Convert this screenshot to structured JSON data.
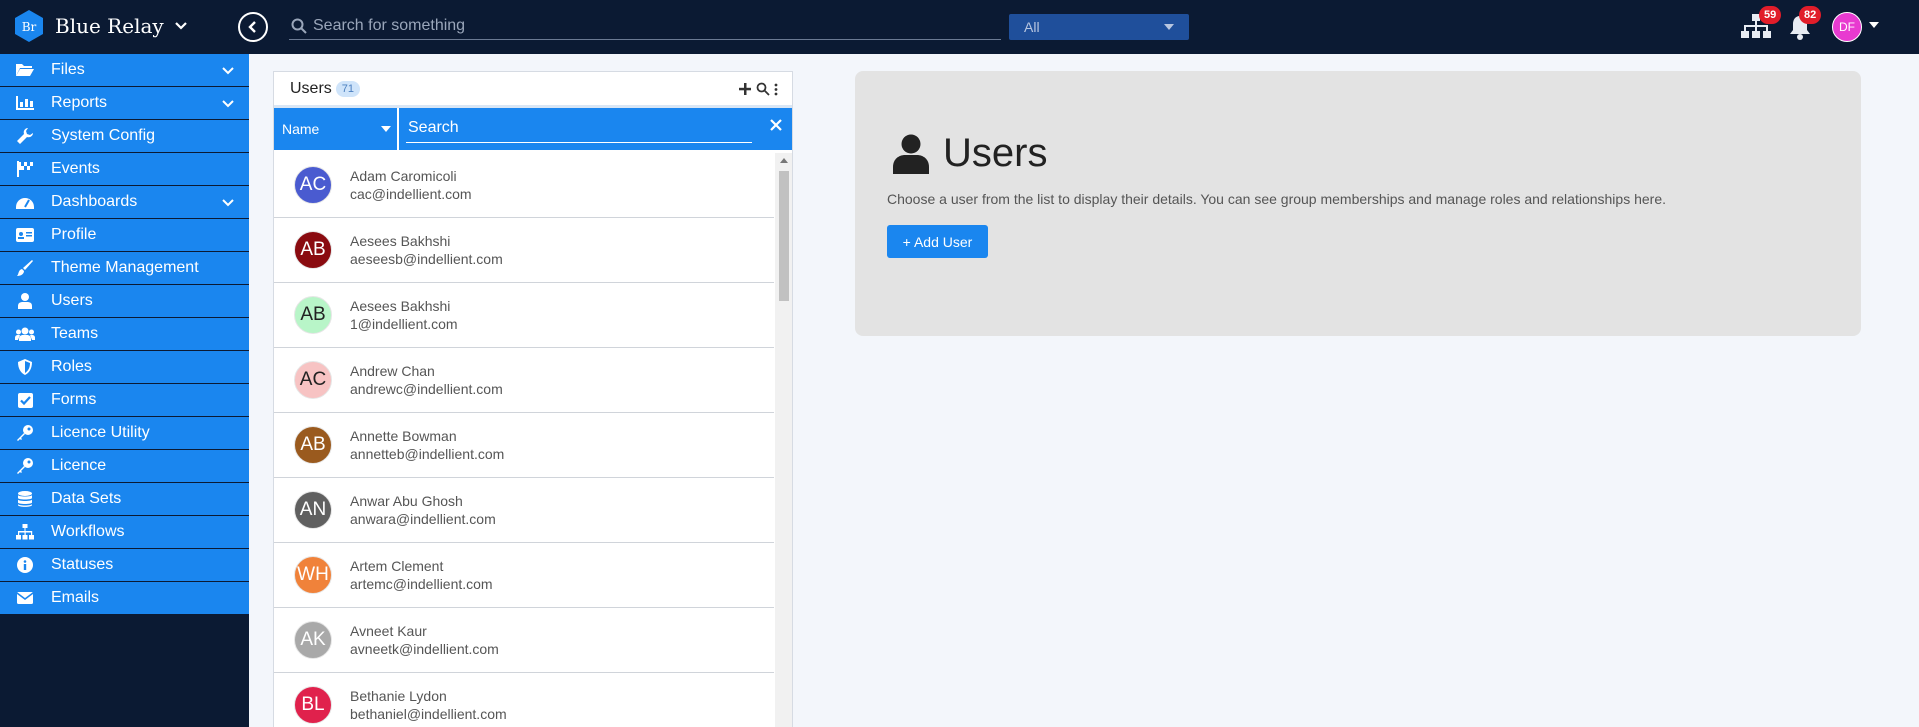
{
  "app": {
    "name": "Blue Relay",
    "logo_text": "Br"
  },
  "topbar": {
    "search_placeholder": "Search for something",
    "scope_value": "All",
    "network_badge": "59",
    "notifications_badge": "82",
    "user_initials": "DF"
  },
  "sidebar": {
    "items": [
      {
        "label": "Files",
        "icon": "folder-open-icon",
        "expandable": true
      },
      {
        "label": "Reports",
        "icon": "bar-chart-icon",
        "expandable": true
      },
      {
        "label": "System Config",
        "icon": "wrench-icon",
        "expandable": false
      },
      {
        "label": "Events",
        "icon": "flag-checkered-icon",
        "expandable": false
      },
      {
        "label": "Dashboards",
        "icon": "gauge-icon",
        "expandable": true
      },
      {
        "label": "Profile",
        "icon": "id-card-icon",
        "expandable": false
      },
      {
        "label": "Theme Management",
        "icon": "paint-brush-icon",
        "expandable": false
      },
      {
        "label": "Users",
        "icon": "user-icon",
        "expandable": false
      },
      {
        "label": "Teams",
        "icon": "users-icon",
        "expandable": false
      },
      {
        "label": "Roles",
        "icon": "shield-icon",
        "expandable": false
      },
      {
        "label": "Forms",
        "icon": "checkbox-icon",
        "expandable": false
      },
      {
        "label": "Licence Utility",
        "icon": "key-icon",
        "expandable": false
      },
      {
        "label": "Licence",
        "icon": "key-icon",
        "expandable": false
      },
      {
        "label": "Data Sets",
        "icon": "database-icon",
        "expandable": false
      },
      {
        "label": "Workflows",
        "icon": "sitemap-icon",
        "expandable": false
      },
      {
        "label": "Statuses",
        "icon": "info-circle-icon",
        "expandable": false
      },
      {
        "label": "Emails",
        "icon": "envelope-icon",
        "expandable": false
      }
    ]
  },
  "users_panel": {
    "title": "Users",
    "count": "71",
    "filter_field": "Name",
    "search_placeholder": "Search",
    "users": [
      {
        "initials": "AC",
        "name": "Adam Caromicoli",
        "email": "cac@indellient.com",
        "bg": "#4a5bd0",
        "fg": "#ffffff"
      },
      {
        "initials": "AB",
        "name": "Aesees Bakhshi",
        "email": "aeseesb@indellient.com",
        "bg": "#8a0b10",
        "fg": "#ffffff"
      },
      {
        "initials": "AB",
        "name": "Aesees Bakhshi",
        "email": "1@indellient.com",
        "bg": "#b8f5c8",
        "fg": "#222222"
      },
      {
        "initials": "AC",
        "name": "Andrew Chan",
        "email": "andrewc@indellient.com",
        "bg": "#f7c3c3",
        "fg": "#222222"
      },
      {
        "initials": "AB",
        "name": "Annette Bowman",
        "email": "annetteb@indellient.com",
        "bg": "#9a5a1e",
        "fg": "#ffffff"
      },
      {
        "initials": "AN",
        "name": "Anwar Abu Ghosh",
        "email": "anwara@indellient.com",
        "bg": "#606060",
        "fg": "#ffffff"
      },
      {
        "initials": "WH",
        "name": "Artem Clement",
        "email": "artemc@indellient.com",
        "bg": "#f0823a",
        "fg": "#ffffff"
      },
      {
        "initials": "AK",
        "name": "Avneet Kaur",
        "email": "avneetk@indellient.com",
        "bg": "#a9a9a9",
        "fg": "#ffffff"
      },
      {
        "initials": "BL",
        "name": "Bethanie Lydon",
        "email": "bethaniel@indellient.com",
        "bg": "#e0214c",
        "fg": "#ffffff"
      }
    ]
  },
  "detail": {
    "title": "Users",
    "description": "Choose a user from the list to display their details. You can see group memberships and manage roles and relationships here.",
    "add_button": "+ Add User"
  },
  "colors": {
    "topbar_bg": "#0b1a33",
    "accent": "#1a86ef",
    "badge": "#e11d2a"
  }
}
